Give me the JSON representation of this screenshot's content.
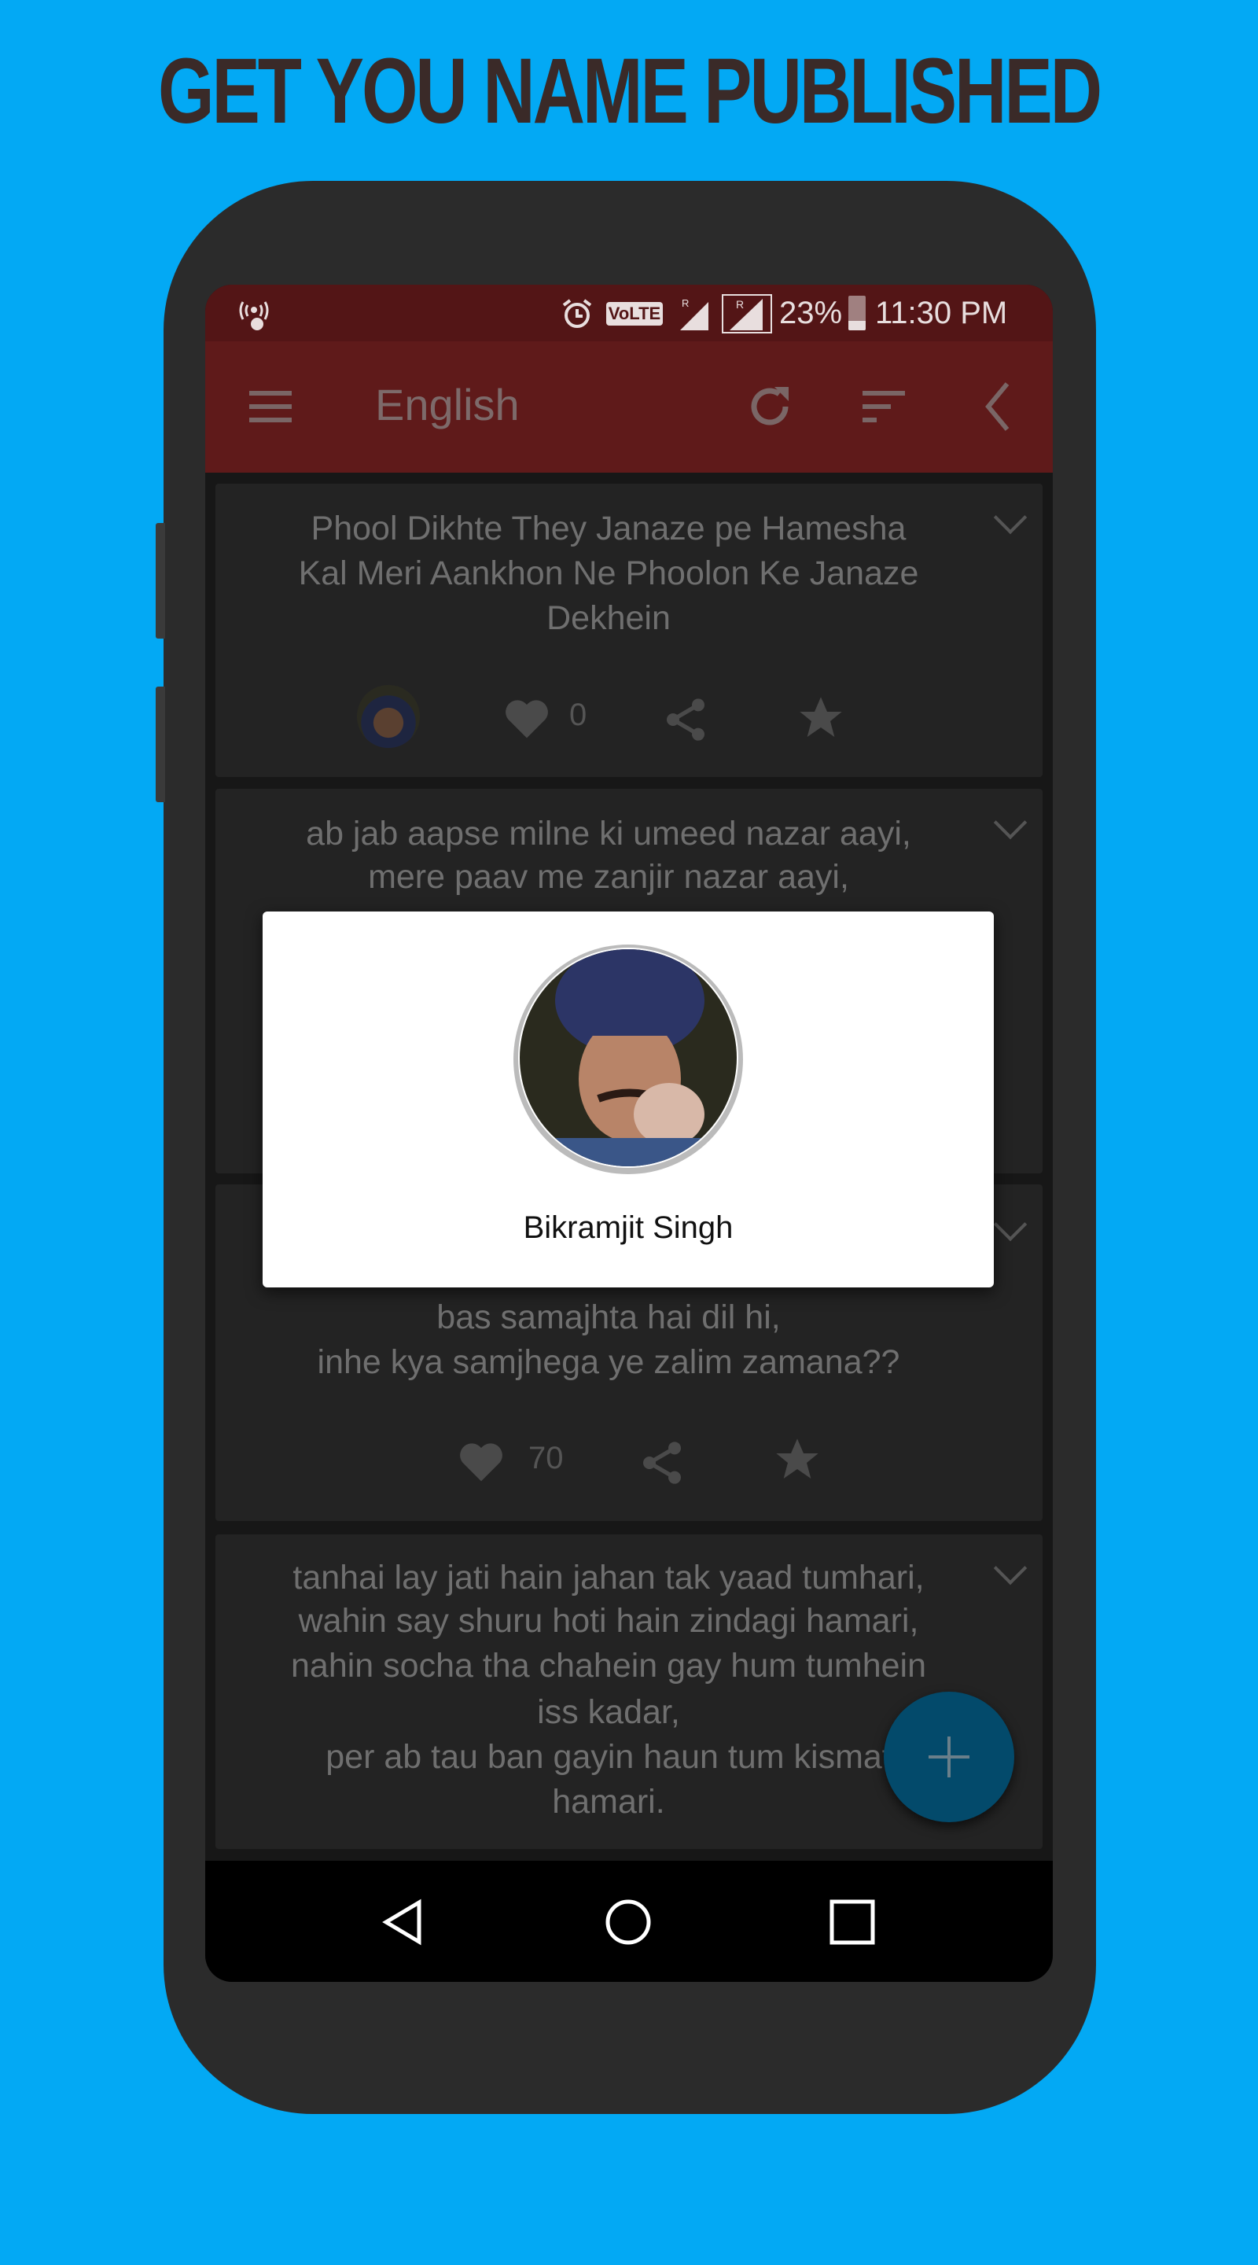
{
  "headline": "GET YOU NAME PUBLISHED",
  "status_bar": {
    "battery": "23%",
    "time": "11:30 PM",
    "volte": "VoLTE",
    "icons": [
      "hotspot-icon",
      "alarm-icon",
      "volte-icon",
      "signal-sim1-icon",
      "signal-sim2-icon",
      "battery-icon"
    ]
  },
  "toolbar": {
    "title": "English",
    "icons": [
      "menu-icon",
      "refresh-icon",
      "sort-icon",
      "back-chevron-icon"
    ]
  },
  "posts": [
    {
      "lines": [
        "Phool Dikhte They Janaze pe Hamesha",
        "Kal Meri Aankhon Ne Phoolon Ke Janaze",
        "Dekhein"
      ],
      "likes": "0"
    },
    {
      "lines": [
        "ab jab aapse milne ki umeed nazar aayi,",
        "mere paav me zanjir nazar aayi,"
      ]
    },
    {
      "lines": [
        "bas samajhta hai dil hi,",
        "inhe kya samjhega ye zalim zamana??"
      ],
      "likes": "70"
    },
    {
      "lines": [
        "tanhai lay jati hain jahan tak yaad tumhari,",
        "wahin say shuru hoti hain zindagi hamari,",
        "nahin socha tha chahein gay hum tumhein",
        "iss kadar,",
        "per ab tau ban gayin haun tum kismat",
        "hamari."
      ]
    }
  ],
  "dialog": {
    "name": "Bikramjit Singh"
  },
  "colors": {
    "background": "#03a9f4",
    "status_bar": "#531516",
    "toolbar": "#5f1a1a",
    "fab": "#034a6b"
  }
}
